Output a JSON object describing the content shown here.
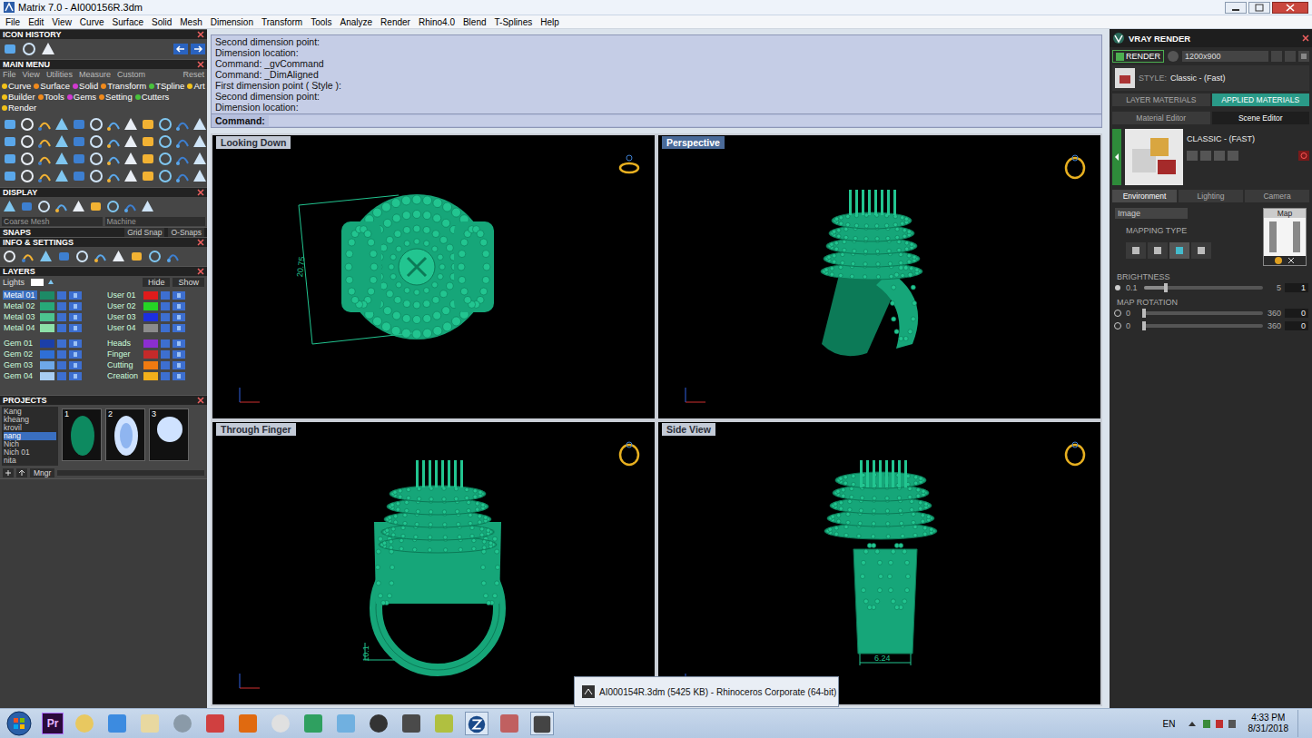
{
  "window": {
    "title": "Matrix 7.0 - AI000156R.3dm"
  },
  "menu": [
    "File",
    "Edit",
    "View",
    "Curve",
    "Surface",
    "Solid",
    "Mesh",
    "Dimension",
    "Transform",
    "Tools",
    "Analyze",
    "Render",
    "Rhino4.0",
    "Blend",
    "T-Splines",
    "Help"
  ],
  "left": {
    "icon_history": {
      "title": "ICON HISTORY"
    },
    "main_menu": {
      "title": "MAIN MENU",
      "tabs": [
        "File",
        "View",
        "Utilities",
        "Measure",
        "Custom"
      ],
      "reset": "Reset",
      "categories": [
        {
          "label": "Curve",
          "color": "#f2c21b"
        },
        {
          "label": "Surface",
          "color": "#f08a1c"
        },
        {
          "label": "Solid",
          "color": "#d03ad0"
        },
        {
          "label": "Transform",
          "color": "#f08a1c"
        },
        {
          "label": "TSpline",
          "color": "#49c23c"
        },
        {
          "label": "Art",
          "color": "#f2c21b"
        },
        {
          "label": "Builder",
          "color": "#f2c21b"
        },
        {
          "label": "Tools",
          "color": "#f08a1c"
        },
        {
          "label": "Gems",
          "color": "#d03ad0"
        },
        {
          "label": "Setting",
          "color": "#f08a1c"
        },
        {
          "label": "Cutters",
          "color": "#49c23c"
        },
        {
          "label": "Render",
          "color": "#f2c21b"
        }
      ]
    },
    "display": {
      "title": "DISPLAY",
      "mesh": "Coarse Mesh",
      "mode": "Machine"
    },
    "snaps": {
      "title": "SNAPS",
      "grid": "Grid Snap",
      "osnaps": "O-Snaps"
    },
    "info": {
      "title": "INFO & SETTINGS"
    },
    "layers": {
      "title": "LAYERS",
      "lights": "Lights",
      "hide": "Hide",
      "show": "Show",
      "items": [
        {
          "name": "Metal 01",
          "color": "#1d8a66",
          "selected": true
        },
        {
          "name": "User 01",
          "color": "#e01b1b",
          "selected": false
        },
        {
          "name": "Metal 02",
          "color": "#27a878",
          "selected": false
        },
        {
          "name": "User 02",
          "color": "#25d425",
          "selected": false
        },
        {
          "name": "Metal 03",
          "color": "#4cc48f",
          "selected": false
        },
        {
          "name": "User 03",
          "color": "#1c2fe0",
          "selected": false
        },
        {
          "name": "Metal 04",
          "color": "#8de0a8",
          "selected": false
        },
        {
          "name": "User 04",
          "color": "#8c8c8c",
          "selected": false
        },
        {
          "name": "Gem 01",
          "color": "#1b3fa8",
          "selected": false
        },
        {
          "name": "Heads",
          "color": "#8b2ed0",
          "selected": false
        },
        {
          "name": "Gem 02",
          "color": "#2f6fd6",
          "selected": false
        },
        {
          "name": "Finger",
          "color": "#c42a2a",
          "selected": false
        },
        {
          "name": "Gem 03",
          "color": "#6ea8e8",
          "selected": false
        },
        {
          "name": "Cutting",
          "color": "#f07a10",
          "selected": false
        },
        {
          "name": "Gem 04",
          "color": "#a8cdf2",
          "selected": false
        },
        {
          "name": "Creation",
          "color": "#f2b01b",
          "selected": false
        }
      ]
    },
    "projects": {
      "title": "PROJECTS",
      "items": [
        {
          "name": "Kang",
          "selected": false
        },
        {
          "name": "kheang",
          "selected": false
        },
        {
          "name": "krovil",
          "selected": false
        },
        {
          "name": "nang",
          "selected": true
        },
        {
          "name": "Nich",
          "selected": false
        },
        {
          "name": "Nich 01",
          "selected": false
        },
        {
          "name": "nita",
          "selected": false
        }
      ],
      "thumbnails": [
        "1",
        "2",
        "3"
      ],
      "manager": "Mngr"
    }
  },
  "command": {
    "lines": [
      "Second dimension point:",
      "Dimension location:",
      "Command: _gvCommand",
      "Command: _DimAligned",
      "First dimension point ( Style ):",
      "Second dimension point:",
      "Dimension location:"
    ],
    "prompt": "Command:"
  },
  "viewports": [
    {
      "label": "Looking Down",
      "dimension": "20.75",
      "active": false
    },
    {
      "label": "Perspective",
      "dimension": "",
      "active": true
    },
    {
      "label": "Through Finger",
      "dimension": "10.1",
      "active": false
    },
    {
      "label": "Side View",
      "dimension": "6.24",
      "active": false
    }
  ],
  "right": {
    "title": "VRAY RENDER",
    "render": "RENDER",
    "resolution": "1200x900",
    "style_label": "STYLE:",
    "style": "Classic - (Fast)",
    "material_tabs": [
      {
        "label": "LAYER MATERIALS",
        "selected": false
      },
      {
        "label": "APPLIED MATERIALS",
        "selected": true
      }
    ],
    "editor_tabs": [
      {
        "label": "Material Editor",
        "selected": false
      },
      {
        "label": "Scene Editor",
        "selected": true
      }
    ],
    "preset": "CLASSIC - (FAST)",
    "scene_tabs": [
      {
        "label": "Environment",
        "selected": true
      },
      {
        "label": "Lighting",
        "selected": false
      },
      {
        "label": "Camera",
        "selected": false
      }
    ],
    "background": "Image",
    "mapping_type": "MAPPING TYPE",
    "map": "Map",
    "brightness": {
      "title": "BRIGHTNESS",
      "min": "0.1",
      "max": "5",
      "value": "1",
      "level": 0.18
    },
    "rotation": {
      "title": "MAP ROTATION",
      "sliders": [
        {
          "min": "0",
          "max": "360",
          "value": "0",
          "level": 0
        },
        {
          "min": "0",
          "max": "360",
          "value": "0",
          "level": 0
        }
      ]
    }
  },
  "tooltip": "AI000154R.3dm (5425 KB) - Rhinoceros Corporate (64-bit)",
  "taskbar": {
    "premiere": "Pr",
    "lang": "EN",
    "time": "4:33 PM",
    "date": "8/31/2018"
  }
}
